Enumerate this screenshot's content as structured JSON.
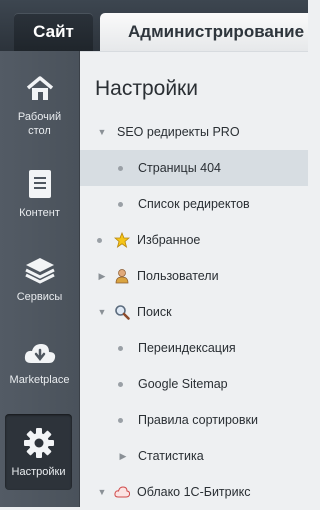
{
  "header": {
    "site_tab": "Сайт",
    "admin_tab": "Администрирование"
  },
  "sidebar": {
    "items": [
      {
        "label_1": "Рабочий",
        "label_2": "стол",
        "icon": "home-icon"
      },
      {
        "label_1": "Контент",
        "icon": "document-icon"
      },
      {
        "label_1": "Сервисы",
        "icon": "layers-icon"
      },
      {
        "label_1": "Marketplace",
        "icon": "cloud-download-icon"
      },
      {
        "label_1": "Настройки",
        "icon": "gear-icon",
        "active": true
      }
    ]
  },
  "panel": {
    "title": "Настройки",
    "items": [
      {
        "label": "SEO редиректы PRO",
        "level": 0,
        "marker": "expanded"
      },
      {
        "label": "Страницы 404",
        "level": 1,
        "selected": true
      },
      {
        "label": "Список редиректов",
        "level": 1
      },
      {
        "label": "Избранное",
        "level": 0,
        "marker": "dot",
        "icon": "star-icon"
      },
      {
        "label": "Пользователи",
        "level": 0,
        "marker": "collapsed",
        "icon": "user-icon"
      },
      {
        "label": "Поиск",
        "level": 0,
        "marker": "expanded",
        "icon": "magnifier-icon"
      },
      {
        "label": "Переиндексация",
        "level": 1
      },
      {
        "label": "Google Sitemap",
        "level": 1
      },
      {
        "label": "Правила сортировки",
        "level": 1
      },
      {
        "label": "Статистика",
        "level": 1,
        "marker": "collapsed"
      },
      {
        "label": "Облако 1С-Битрикс",
        "level": 0,
        "marker": "expanded",
        "icon": "cloud-icon"
      }
    ]
  }
}
